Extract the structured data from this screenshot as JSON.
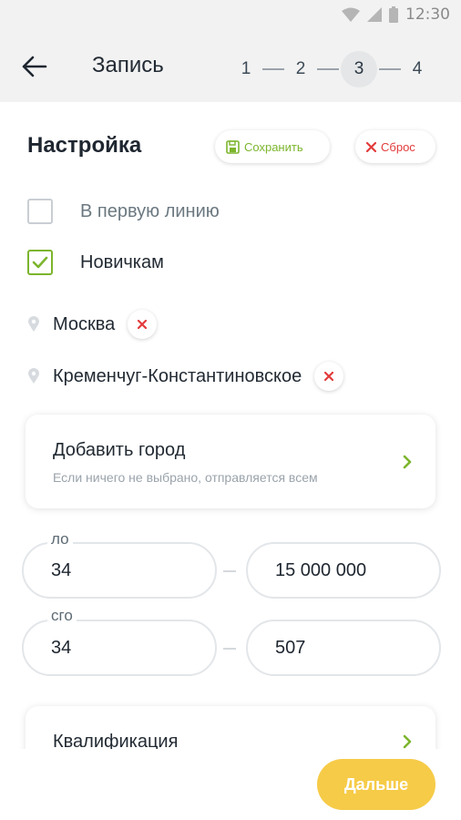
{
  "status_bar": {
    "time": "12:30",
    "icons": [
      "wifi-icon",
      "signal-icon",
      "battery-icon"
    ]
  },
  "app_bar": {
    "back_icon": "arrow-left-icon",
    "title": "Запись",
    "steps": [
      "1",
      "2",
      "3",
      "4"
    ],
    "active_step": "3"
  },
  "settings": {
    "title": "Настройка",
    "save_label": "Сохранить",
    "reset_label": "Сброс"
  },
  "options": [
    {
      "label": "В первую линию",
      "checked": false
    },
    {
      "label": "Новичкам",
      "checked": true
    }
  ],
  "cities": [
    "Москва",
    "Кременчуг-Константиновское"
  ],
  "add_city": {
    "title": "Добавить город",
    "hint": "Если ничего не выбрано, отправляется всем"
  },
  "ranges": [
    {
      "label": "ло",
      "from": "34",
      "to": "15 000 000"
    },
    {
      "label": "сго",
      "from": "34",
      "to": "507"
    }
  ],
  "qualification": {
    "title": "Квалификация"
  },
  "next_label": "Дальше",
  "colors": {
    "accent_green": "#7cb52d",
    "danger_red": "#e33b3b",
    "button_yellow": "#f6cb48",
    "header_gray": "#f2f2f2"
  }
}
